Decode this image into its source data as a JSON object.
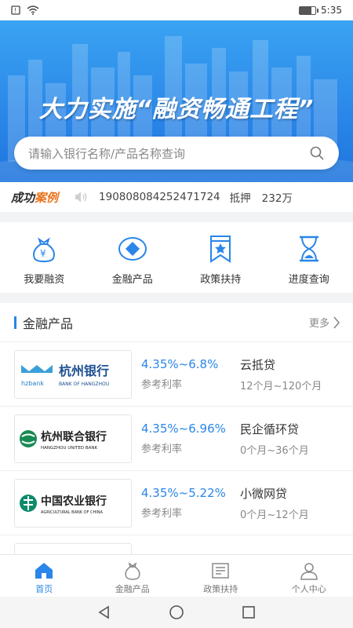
{
  "status_bar": {
    "time": "5:35"
  },
  "banner": {
    "title": "大力实施“融资畅通工程”",
    "search_placeholder": "请输入银行名称/产品名称查询"
  },
  "ticker": {
    "tag_part1": "成功",
    "tag_part2": "案例",
    "case_number": "19080808425247​1724",
    "type": "抵押",
    "amount": "232万"
  },
  "quick_menu": [
    {
      "label": "我要融资",
      "icon": "money-bag-icon"
    },
    {
      "label": "金融产品",
      "icon": "diamond-icon"
    },
    {
      "label": "政策扶持",
      "icon": "bookmark-star-icon"
    },
    {
      "label": "进度查询",
      "icon": "hourglass-icon"
    }
  ],
  "products_section": {
    "title": "金融产品",
    "more_label": "更多",
    "items": [
      {
        "bank_name": "杭州银行",
        "bank_en": "BANK OF HANGZHOU",
        "bank_prefix": "hzbank",
        "rate": "4.35%~6.8%",
        "rate_label": "参考利率",
        "product": "云抵贷",
        "term": "12个月~120个月"
      },
      {
        "bank_name": "杭州联合银行",
        "bank_en": "HANGZHOU UNITED BANK",
        "rate": "4.35%~6.96%",
        "rate_label": "参考利率",
        "product": "民企循环贷",
        "term": "0个月~36个月"
      },
      {
        "bank_name": "中国农业银行",
        "bank_en": "AGRICULTURAL BANK OF CHINA",
        "rate": "4.35%~5.22%",
        "rate_label": "参考利率",
        "product": "小微网贷",
        "term": "0个月~12个月"
      }
    ]
  },
  "tabbar": [
    {
      "label": "首页",
      "active": true
    },
    {
      "label": "金融产品",
      "active": false
    },
    {
      "label": "政策扶持",
      "active": false
    },
    {
      "label": "个人中心",
      "active": false
    }
  ],
  "colors": {
    "primary": "#2a86e8",
    "accent": "#e9731c"
  }
}
